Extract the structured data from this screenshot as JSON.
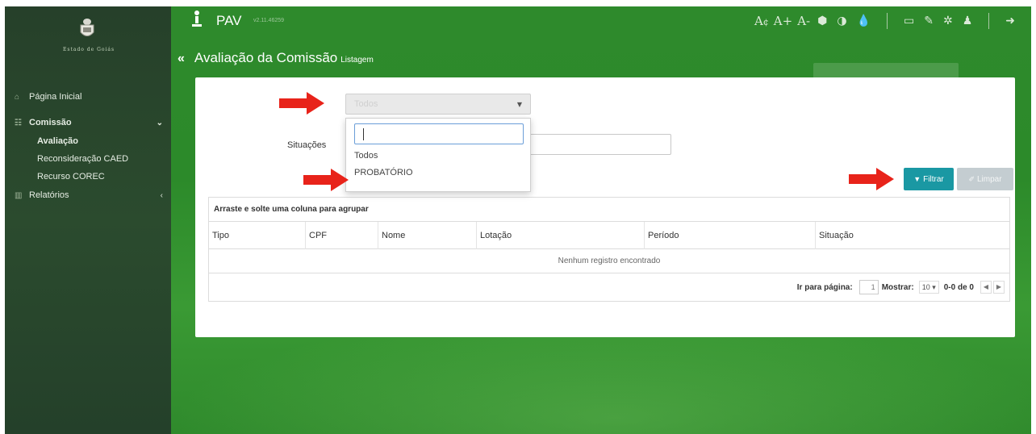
{
  "logo": {
    "text": "Estado de Goiás",
    "icon": "crest-icon"
  },
  "app": {
    "name": "PAV",
    "version": "v2.11.46259"
  },
  "toolbar": {
    "font_a": "A",
    "font_plus": "A+",
    "font_minus": "A-",
    "icons": [
      "text-size-icon",
      "cube-icon",
      "contrast-icon",
      "drop-icon",
      "monitor-icon",
      "brush-icon",
      "gear-icon",
      "user-icon",
      "logout-icon"
    ]
  },
  "sidebar": {
    "items": [
      {
        "label": "Página Inicial",
        "icon": "home-icon"
      },
      {
        "label": "Comissão",
        "icon": "group-icon",
        "chevron": "⌄"
      },
      {
        "label": "Relatórios",
        "icon": "bar-chart-icon",
        "chevron": "‹"
      }
    ],
    "sub_items": [
      {
        "label": "Avaliação",
        "active": true
      },
      {
        "label": "Reconsideração CAED",
        "active": false
      },
      {
        "label": "Recurso COREC",
        "active": false
      }
    ]
  },
  "page": {
    "back": "«",
    "title": "Avaliação da Comissão",
    "subtitle": "Listagem"
  },
  "filters": {
    "select_value": "Todos",
    "situacoes_label": "Situações",
    "dropdown": {
      "search_value": "",
      "options": [
        "Todos",
        "PROBATÓRIO"
      ]
    }
  },
  "buttons": {
    "filter": "Filtrar",
    "clear": "Limpar"
  },
  "grid": {
    "group_hint": "Arraste e solte uma coluna para agrupar",
    "columns": [
      "Tipo",
      "CPF",
      "Nome",
      "Lotação",
      "Período",
      "Situação"
    ],
    "empty_message": "Nenhum registro encontrado",
    "pager": {
      "goto_label": "Ir para página:",
      "page": "1",
      "show_label": "Mostrar:",
      "page_size": "10",
      "count": "0-0 de 0",
      "prev": "◀",
      "next": "▶"
    }
  },
  "colors": {
    "accent": "#1a98a3",
    "arrow": "#e8231a",
    "sidebar": "#2b4b2e",
    "background": "#2e8a2c"
  }
}
